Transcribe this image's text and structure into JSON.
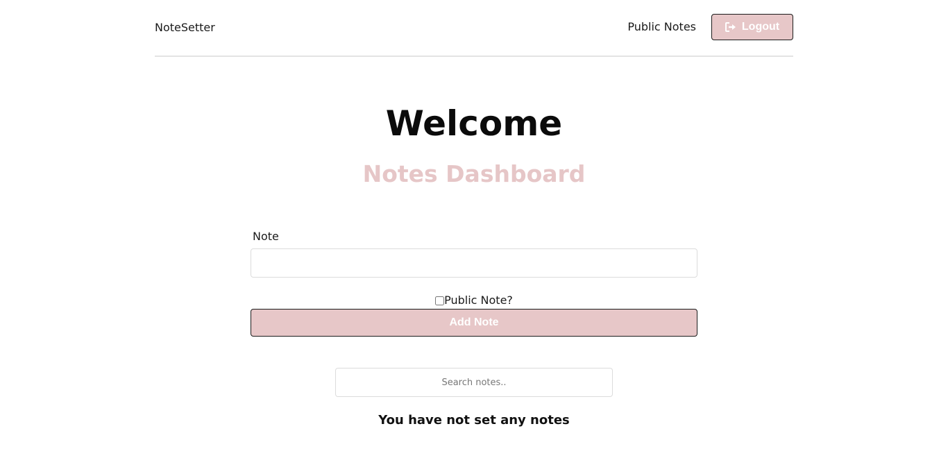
{
  "navbar": {
    "brand": "NoteSetter",
    "public_notes_link": "Public Notes",
    "logout_label": "Logout",
    "logout_icon": "sign-out-icon"
  },
  "main": {
    "title": "Welcome",
    "subtitle": "Notes Dashboard",
    "note_label": "Note",
    "note_value": "",
    "public_checkbox_label": "Public Note?",
    "public_checked": false,
    "add_button_label": "Add Note",
    "search_placeholder": "Search notes..",
    "empty_message": "You have not set any notes"
  },
  "colors": {
    "accent": "#e7c7c8",
    "subtitle": "#e6c6c7",
    "text": "#111111",
    "border": "#dcdcdc"
  }
}
